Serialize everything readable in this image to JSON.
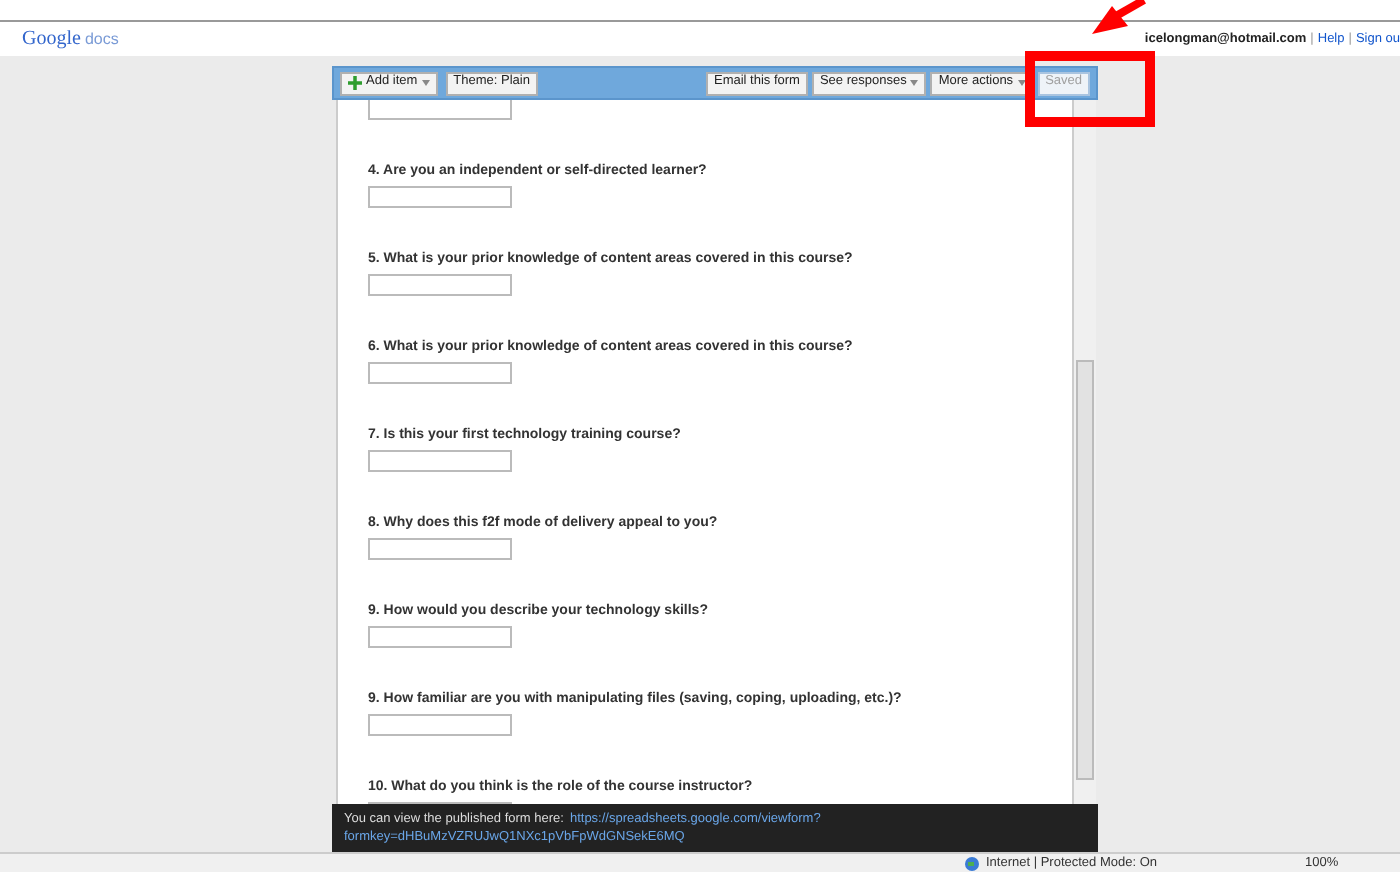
{
  "header": {
    "logo": {
      "brand": "Google",
      "product": "docs"
    },
    "account": "icelongman@hotmail.com",
    "links": [
      {
        "kind": "separator",
        "label": "|"
      },
      {
        "kind": "link",
        "label": "Help"
      },
      {
        "kind": "separator",
        "label": "|"
      },
      {
        "kind": "link",
        "label": "Sign ou"
      }
    ]
  },
  "toolbar": {
    "left": [
      {
        "label": "Add item",
        "kind": "add",
        "disabled": false
      },
      {
        "label": "Theme:  Plain",
        "kind": "plain",
        "disabled": false
      }
    ],
    "right": [
      {
        "label": "Email this form",
        "kind": "plain",
        "disabled": false
      },
      {
        "label": "See responses",
        "kind": "dropdown",
        "disabled": false
      },
      {
        "label": "More actions",
        "kind": "dropdown",
        "disabled": false
      },
      {
        "label": "Saved",
        "kind": "plain",
        "disabled": true
      }
    ]
  },
  "questions": [
    {
      "label": "4. Are you an independent or self-directed learner?"
    },
    {
      "label": "5. What is your prior knowledge of content areas covered in this course?"
    },
    {
      "label": "6. What is your prior knowledge of content areas covered in this course?"
    },
    {
      "label": "7. Is this your first technology training course?"
    },
    {
      "label": "8. Why does this f2f mode of delivery appeal to you?"
    },
    {
      "label": "9. How would you describe your technology skills?"
    },
    {
      "label": "9. How familiar are you with manipulating files (saving, coping, uploading, etc.)?"
    },
    {
      "label": "10. What do you think is the role of the course instructor?"
    }
  ],
  "footer": {
    "text": "You can view the published form here:",
    "link_lines": [
      "https://spreadsheets.google.com/viewform?",
      "formkey=dHBuMzVZRUJwQ1NXc1pVbFpWdGNSekE6MQ"
    ]
  },
  "status_bar": {
    "zone": "Internet | Protected Mode: On",
    "zoom": "100%"
  }
}
